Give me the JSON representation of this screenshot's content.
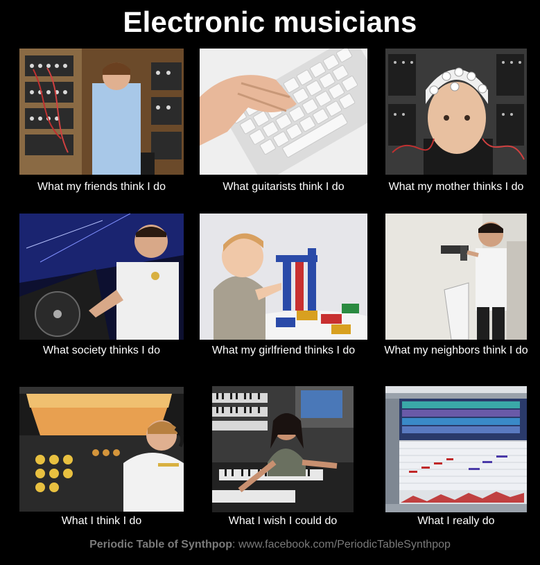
{
  "meme": {
    "title": "Electronic musicians",
    "panels": [
      {
        "caption": "What my friends think I do"
      },
      {
        "caption": "What guitarists think I do"
      },
      {
        "caption": "What my mother thinks I do"
      },
      {
        "caption": "What society thinks I do"
      },
      {
        "caption": "What my girlfriend thinks I do"
      },
      {
        "caption": "What my neighbors think I do"
      },
      {
        "caption": "What I think I do"
      },
      {
        "caption": "What I wish I could do"
      },
      {
        "caption": "What I really do"
      }
    ],
    "footer": {
      "label": "Periodic Table of Synthpop",
      "separator": ":",
      "url": "www.facebook.com/PeriodicTableSynthpop"
    }
  }
}
